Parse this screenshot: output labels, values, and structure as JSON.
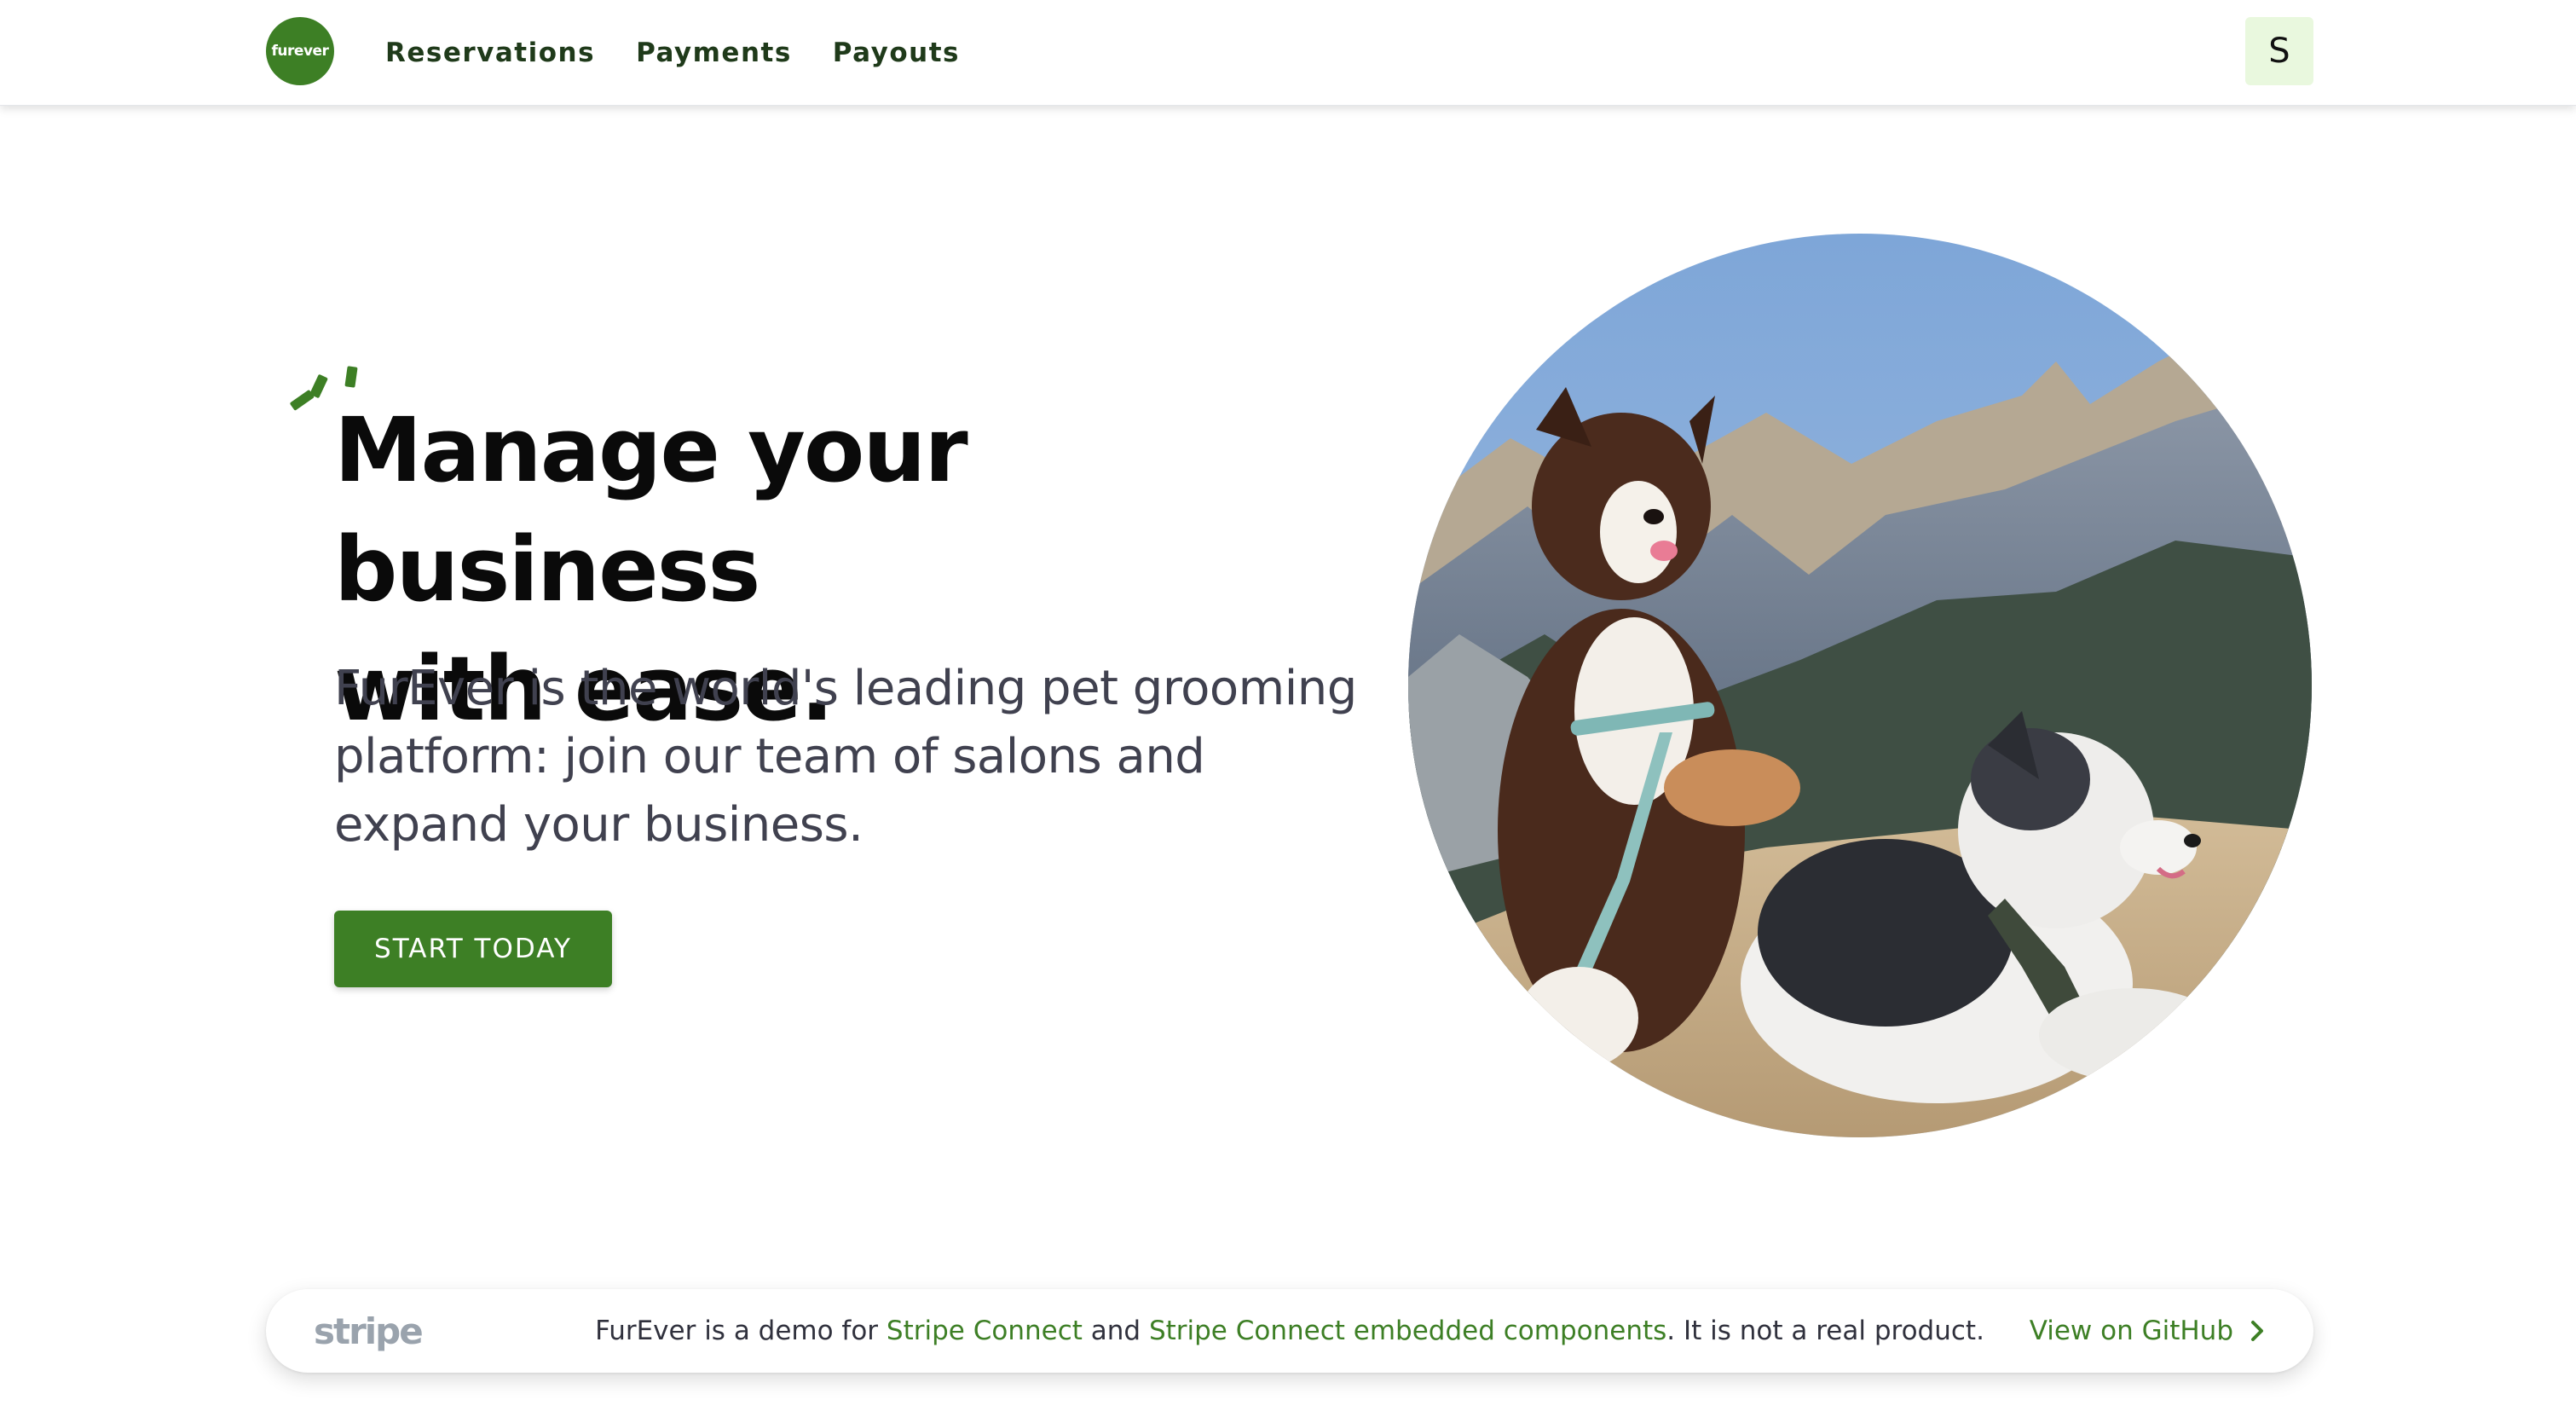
{
  "nav": {
    "logo_text": "furever",
    "links": [
      "Reservations",
      "Payments",
      "Payouts"
    ],
    "avatar_initial": "S"
  },
  "hero": {
    "title_line1": "Manage your business",
    "title_line2": "with ease.",
    "subtitle": "FurEver is the world's leading pet grooming platform: join our team of salons and expand your business.",
    "cta_label": "START TODAY",
    "image_alt": "Two Australian Shepherd dogs sitting on a mountain summit"
  },
  "banner": {
    "brand": "stripe",
    "text_before": "FurEver is a demo for ",
    "link1": "Stripe Connect",
    "text_mid": " and ",
    "link2": "Stripe Connect embedded components",
    "text_after": ". It is not a real product.",
    "github_label": "View on GitHub"
  },
  "colors": {
    "brand_green": "#3d7f25",
    "avatar_bg": "#e9f8de",
    "text_dark": "#0a0a0a",
    "text_muted": "#40414f"
  },
  "icons": {
    "sparkle": "sparkle-icon",
    "chevron": "chevron-right-icon"
  }
}
